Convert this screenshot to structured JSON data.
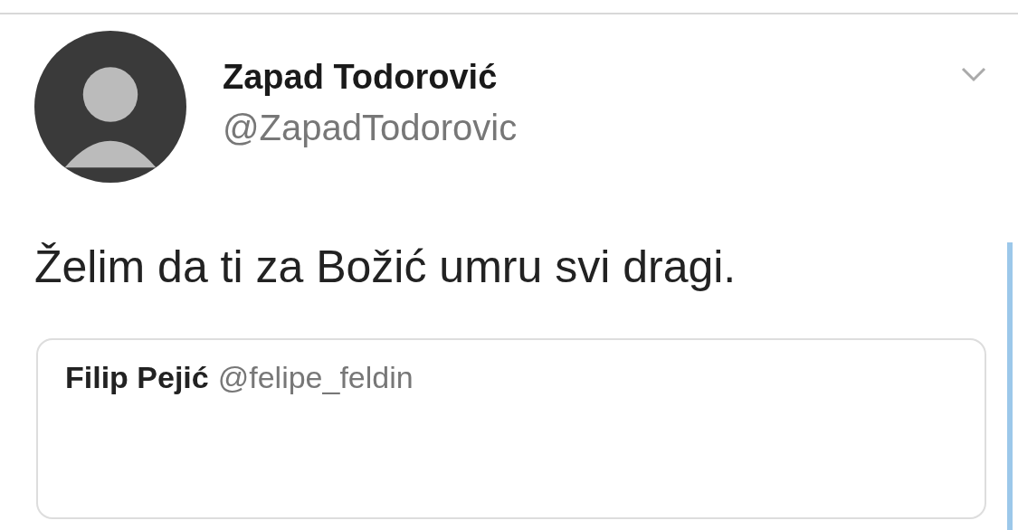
{
  "author": {
    "name": "Zapad Todorović",
    "handle": "@ZapadTodorovic"
  },
  "tweet": {
    "text": "Želim da ti za Božić umru svi dragi."
  },
  "quoted": {
    "name": "Filip Pejić",
    "handle": "@felipe_feldin"
  }
}
